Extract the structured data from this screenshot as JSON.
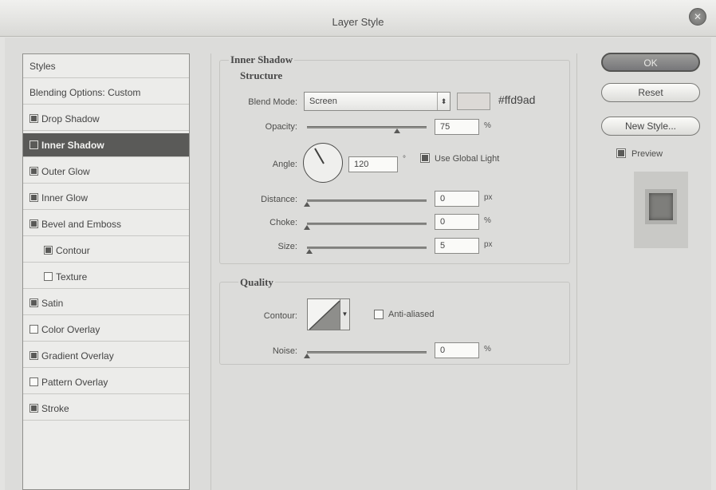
{
  "window": {
    "title": "Layer Style"
  },
  "styles_list": {
    "header": "Styles",
    "blending": "Blending Options: Custom",
    "items": [
      {
        "label": "Drop Shadow",
        "checked": true,
        "selected": false,
        "sub": false
      },
      {
        "label": "Inner Shadow",
        "checked": true,
        "selected": true,
        "sub": false
      },
      {
        "label": "Outer Glow",
        "checked": true,
        "selected": false,
        "sub": false
      },
      {
        "label": "Inner Glow",
        "checked": true,
        "selected": false,
        "sub": false
      },
      {
        "label": "Bevel and Emboss",
        "checked": true,
        "selected": false,
        "sub": false
      },
      {
        "label": "Contour",
        "checked": true,
        "selected": false,
        "sub": true
      },
      {
        "label": "Texture",
        "checked": false,
        "selected": false,
        "sub": true
      },
      {
        "label": "Satin",
        "checked": true,
        "selected": false,
        "sub": false
      },
      {
        "label": "Color Overlay",
        "checked": false,
        "selected": false,
        "sub": false
      },
      {
        "label": "Gradient Overlay",
        "checked": true,
        "selected": false,
        "sub": false
      },
      {
        "label": "Pattern Overlay",
        "checked": false,
        "selected": false,
        "sub": false
      },
      {
        "label": "Stroke",
        "checked": true,
        "selected": false,
        "sub": false
      }
    ]
  },
  "inner_shadow": {
    "section_title": "Inner Shadow",
    "structure_title": "Structure",
    "blend_mode": {
      "label": "Blend Mode:",
      "value": "Screen"
    },
    "color": {
      "swatch": "#dcd9d6",
      "hex_label": "#ffd9ad"
    },
    "opacity": {
      "label": "Opacity:",
      "value": "75",
      "unit": "%",
      "level": 0.75
    },
    "angle": {
      "label": "Angle:",
      "value": "120",
      "unit": "°",
      "degrees": 120
    },
    "use_global_light": {
      "label": "Use Global Light",
      "checked": true
    },
    "distance": {
      "label": "Distance:",
      "value": "0",
      "unit": "px",
      "level": 0
    },
    "choke": {
      "label": "Choke:",
      "value": "0",
      "unit": "%",
      "level": 0
    },
    "size": {
      "label": "Size:",
      "value": "5",
      "unit": "px",
      "level": 0.02
    }
  },
  "quality": {
    "section_title": "Quality",
    "contour_label": "Contour:",
    "anti_aliased": {
      "label": "Anti-aliased",
      "checked": false
    },
    "noise": {
      "label": "Noise:",
      "value": "0",
      "unit": "%",
      "level": 0
    }
  },
  "buttons": {
    "ok": "OK",
    "reset": "Reset",
    "new_style": "New Style..."
  },
  "preview": {
    "label": "Preview",
    "checked": true
  },
  "icons": {
    "close": "close-icon",
    "dropdown": "chevron-down-icon",
    "angle": "angle-dial-icon",
    "contour": "contour-curve-icon"
  }
}
